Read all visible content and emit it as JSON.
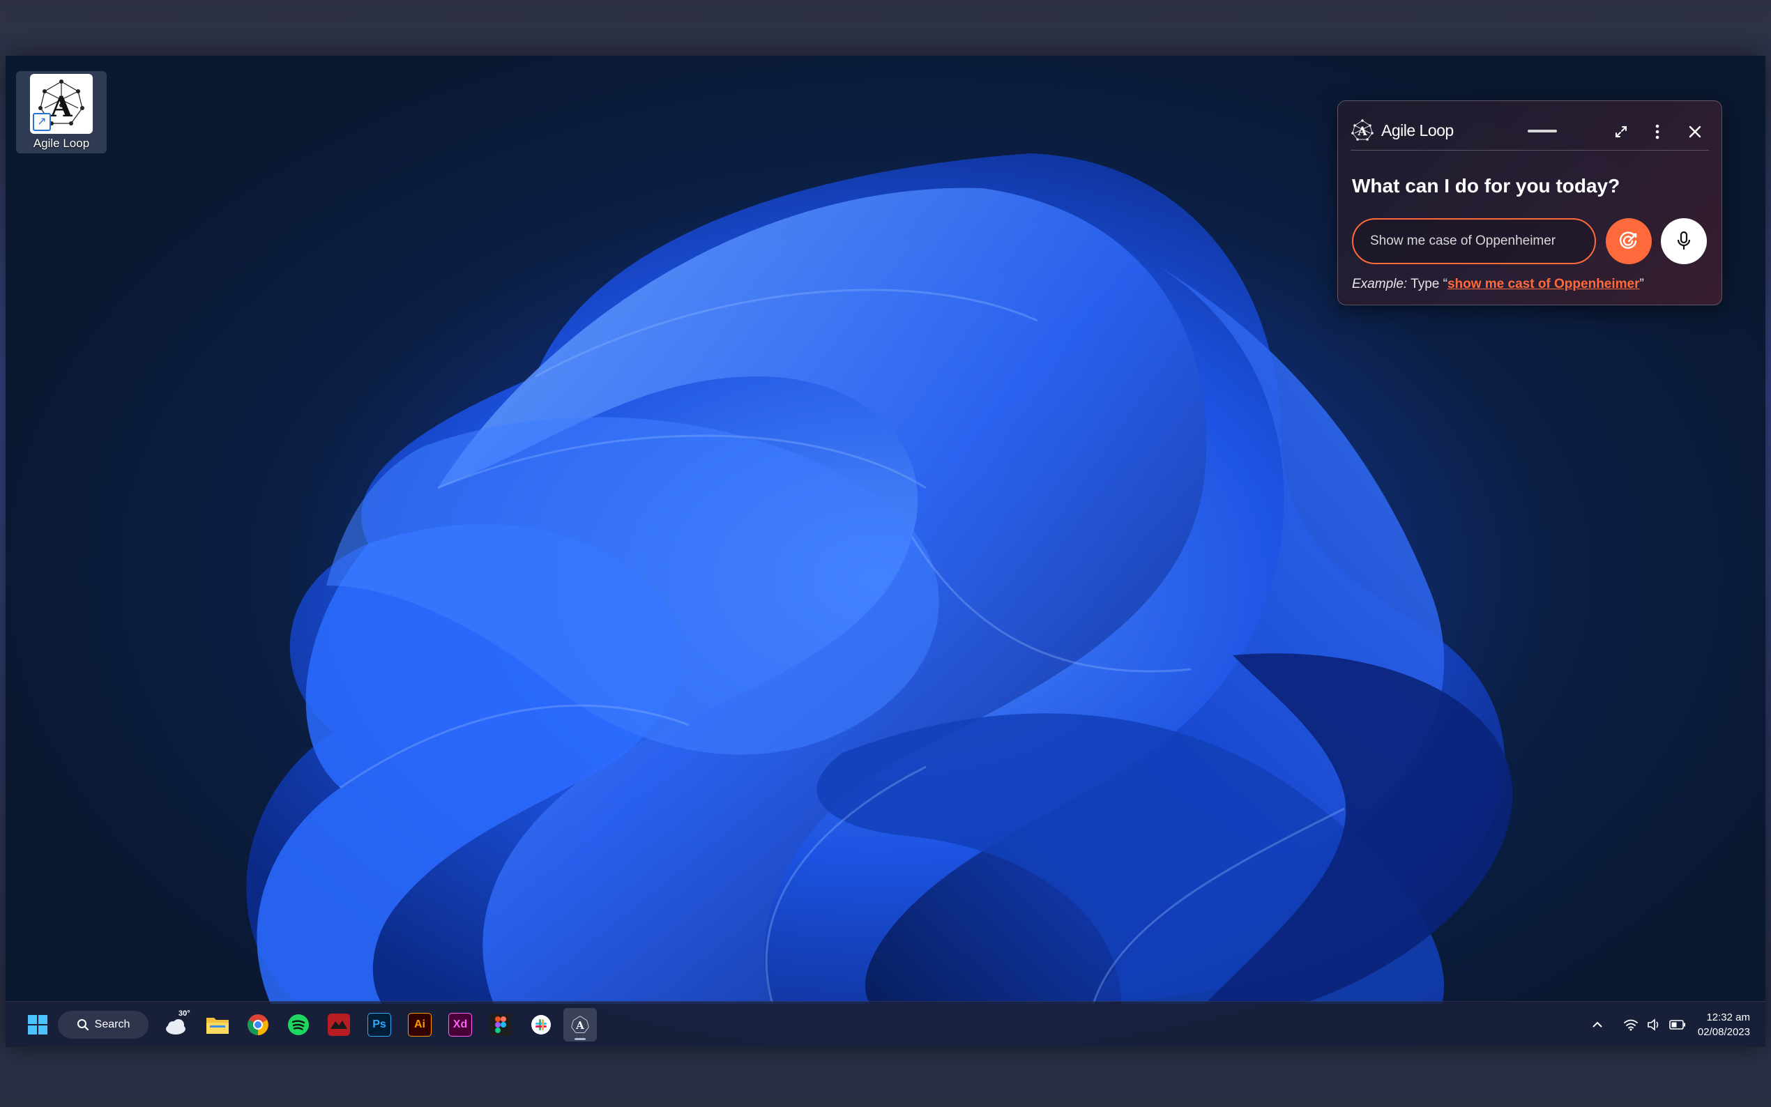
{
  "desktop": {
    "icon_label": "Agile Loop"
  },
  "assistant": {
    "brand_name": "Agile Loop",
    "title": "What can I do for you today?",
    "input_value": "Show me case of Oppenheimer",
    "example_lead": "Example:",
    "example_type": " Type “",
    "example_link": "show me cast of Oppenheimer",
    "example_close": "”",
    "accent_color": "#ff6a3d"
  },
  "taskbar": {
    "search_label": "Search",
    "weather_temp": "30°",
    "apps": [
      "start-icon",
      "weather-icon",
      "file-explorer-icon",
      "chrome-icon",
      "spotify-icon",
      "app-red-icon",
      "photoshop-icon",
      "illustrator-icon",
      "xd-icon",
      "figma-icon",
      "slack-icon",
      "agile-loop-icon"
    ],
    "ps_label": "Ps",
    "ai_label": "Ai",
    "xd_label": "Xd",
    "time": "12:32 am",
    "date": "02/08/2023"
  }
}
